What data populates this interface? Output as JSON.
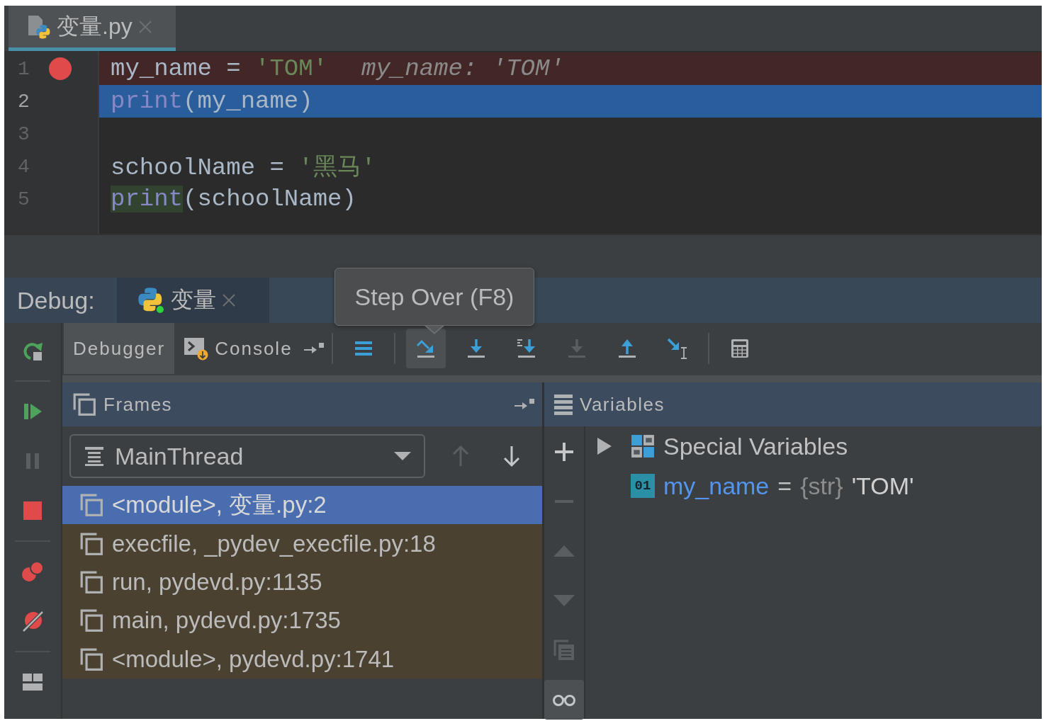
{
  "editor": {
    "tabs": [
      {
        "label": "变量.py",
        "selected": true
      }
    ],
    "lines": [
      {
        "number": "1",
        "breakpoint": true,
        "current": false,
        "tokens": [
          {
            "text": "my_name = ",
            "kind": "plain",
            "marked": false
          },
          {
            "text": "'TOM'",
            "kind": "string",
            "marked": false
          }
        ],
        "inline_value": "my_name: 'TOM'"
      },
      {
        "number": "2",
        "breakpoint": false,
        "current": true,
        "tokens": [
          {
            "text": "print",
            "kind": "builtin",
            "marked": false
          },
          {
            "text": "(my_name)",
            "kind": "plain",
            "marked": false
          }
        ]
      },
      {
        "number": "3",
        "breakpoint": false,
        "current": false
      },
      {
        "number": "4",
        "breakpoint": false,
        "current": false,
        "tokens": [
          {
            "text": "schoolName = ",
            "kind": "plain",
            "marked": false
          },
          {
            "text": "'黑马'",
            "kind": "string",
            "marked": false
          }
        ]
      },
      {
        "number": "5",
        "breakpoint": false,
        "current": false,
        "tokens": [
          {
            "text": "print",
            "kind": "builtin",
            "marked": true
          },
          {
            "text": "(schoolName)",
            "kind": "plain",
            "marked": false
          }
        ]
      }
    ]
  },
  "debug": {
    "label": "Debug:",
    "sessions": [
      {
        "label": "变量",
        "selected": true
      }
    ],
    "tooltip": "Step Over (F8)",
    "side_toolbar": [
      {
        "kind": "rerun",
        "disabled": false
      },
      {
        "kind": "resume",
        "disabled": false
      },
      {
        "kind": "pause",
        "disabled": true
      },
      {
        "kind": "stop",
        "disabled": false
      },
      {
        "kind": "view-breakpoints",
        "disabled": false
      },
      {
        "kind": "mute-breakpoints",
        "disabled": false
      },
      {
        "kind": "layout",
        "disabled": false
      }
    ],
    "tabs": [
      {
        "label": "Debugger",
        "selected": true
      },
      {
        "label": "Console",
        "selected": false
      }
    ],
    "toolbar": [
      {
        "kind": "execution-point",
        "disabled": false,
        "hovered": false
      },
      {
        "kind": "step-over",
        "disabled": false,
        "hovered": true
      },
      {
        "kind": "step-into",
        "disabled": false,
        "hovered": false
      },
      {
        "kind": "step-into-my-code",
        "disabled": false,
        "hovered": false
      },
      {
        "kind": "force-step-into",
        "disabled": true,
        "hovered": false
      },
      {
        "kind": "step-out",
        "disabled": false,
        "hovered": false
      },
      {
        "kind": "run-to-cursor",
        "disabled": false,
        "hovered": false
      },
      {
        "kind": "evaluate",
        "disabled": false,
        "hovered": false
      }
    ],
    "frames": {
      "title": "Frames",
      "thread": "MainThread",
      "thread_nav": [
        {
          "kind": "up",
          "disabled": true
        },
        {
          "kind": "down",
          "disabled": false
        }
      ],
      "items": [
        {
          "label": "<module>, 变量.py:2",
          "selected": true,
          "library": false
        },
        {
          "label": "execfile, _pydev_execfile.py:18",
          "selected": false,
          "library": true
        },
        {
          "label": "run, pydevd.py:1135",
          "selected": false,
          "library": true
        },
        {
          "label": "main, pydevd.py:1735",
          "selected": false,
          "library": true
        },
        {
          "label": "<module>, pydevd.py:1741",
          "selected": false,
          "library": true
        }
      ]
    },
    "variables": {
      "title": "Variables",
      "toolbar": [
        {
          "kind": "add",
          "disabled": false,
          "on": false
        },
        {
          "kind": "remove",
          "disabled": true,
          "on": false
        },
        {
          "kind": "move-up",
          "disabled": true,
          "on": false
        },
        {
          "kind": "move-down",
          "disabled": true,
          "on": false
        },
        {
          "kind": "copy",
          "disabled": true,
          "on": false
        },
        {
          "kind": "watches",
          "disabled": false,
          "on": true
        }
      ],
      "tree": [
        {
          "kind": "group",
          "name": "Special Variables",
          "expanded": false
        },
        {
          "kind": "value",
          "badge": "01",
          "name": "my_name",
          "operator": "=",
          "value_type": "{str}",
          "value": "'TOM'"
        }
      ]
    }
  }
}
